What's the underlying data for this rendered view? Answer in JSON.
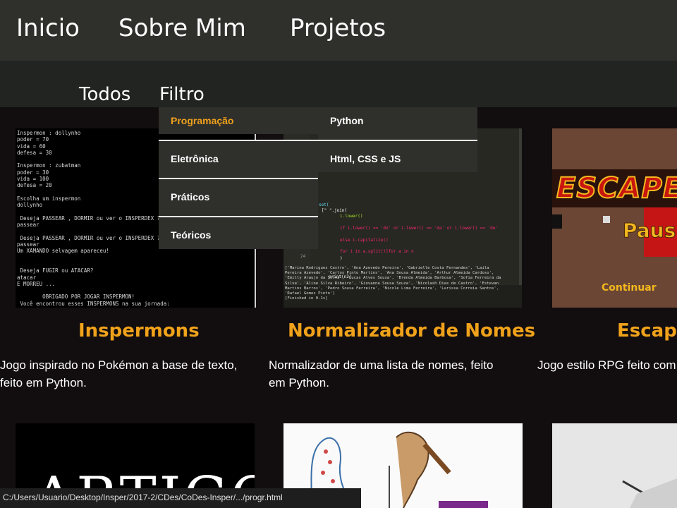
{
  "topnav": {
    "items": [
      {
        "label": "Inicio"
      },
      {
        "label": "Sobre Mim"
      },
      {
        "label": "Projetos"
      }
    ]
  },
  "subnav": {
    "all_label": "Todos",
    "filter_label": "Filtro"
  },
  "filter_menu": {
    "categories": [
      {
        "label": "Programação",
        "active": true
      },
      {
        "label": "Eletrônica"
      },
      {
        "label": "Práticos"
      },
      {
        "label": "Teóricos"
      }
    ],
    "submenu": [
      {
        "label": "Python"
      },
      {
        "label": "Html, CSS e JS"
      }
    ]
  },
  "cards": [
    {
      "title": "Inspermons",
      "desc_line1": "Jogo inspirado no Pokémon a base de texto,",
      "desc_line2": "feito em Python.",
      "terminal": "Inspermon : dollynho\npoder = 70\nvida = 60\ndefesa = 30\n\nInspermon : zubatman\npoder = 30\nvida = 100\ndefesa = 20\n\nEscolha um inspermon\ndollynho\n\n Deseja PASSEAR , DORMIR ou ver o INSPERDEX ?\npassear\n\n Deseja PASSEAR , DORMIR ou ver o INSPERDEX ?\npassear\nUm XAMANDO selvagem apareceu!\n\n\n Deseja FUGIR ou ATACAR?\natacar\nE MORREU ...\n\n        OBRIGADO POR JOGAR INSPERMON!\n Você encontrou esses INSPERMONS na sua jornada:\n['xamando']"
    },
    {
      "title": "Normalizador de Nomes",
      "desc_line1": "Normalizador de uma lista de nomes, feito",
      "desc_line2": "em Python.",
      "output": "['Marina Rodrigues Castro', 'Ana Azevedo Pereira', 'Gabrielle Costa Fernandes', 'Laila\nPereira Azevedo', 'Carlos Pinto Martins', 'Ana Sousa Almeida', 'Arthur Almeida Cardoso',\n'Emilly Araujo da Silva', 'Lucas Alves Sousa', 'Brenda Almeida Barbosa', 'Sofia Ferreira da\nSilva', 'Aline Silva Ribeiro', 'Giovanna Sousa Souza', 'Nicolash Dias de Castro', 'Estevan\nMartins Barros', 'Pedro Sousa Ferreira', 'Nicole Lima Ferreira', 'Larissa Correia Santos',\n'Rafael Gomes Pinto']\n[Finished in 0.1s]"
    },
    {
      "title": "Escape",
      "desc_line1": "Jogo estilo RPG feito com",
      "logo_text": "ESCAPE",
      "pause_text": "Paus",
      "continue_text": "Continuar"
    }
  ],
  "row2": {
    "card1_text": "ARTIGO"
  },
  "statusbar": {
    "url": "C:/Users/Usuario/Desktop/Insper/2017-2/CDes/CoDes-Insper/.../progr.html"
  },
  "colors": {
    "accent": "#f0a21b",
    "topbar": "#2f2f2c",
    "background": "#120d0e"
  }
}
